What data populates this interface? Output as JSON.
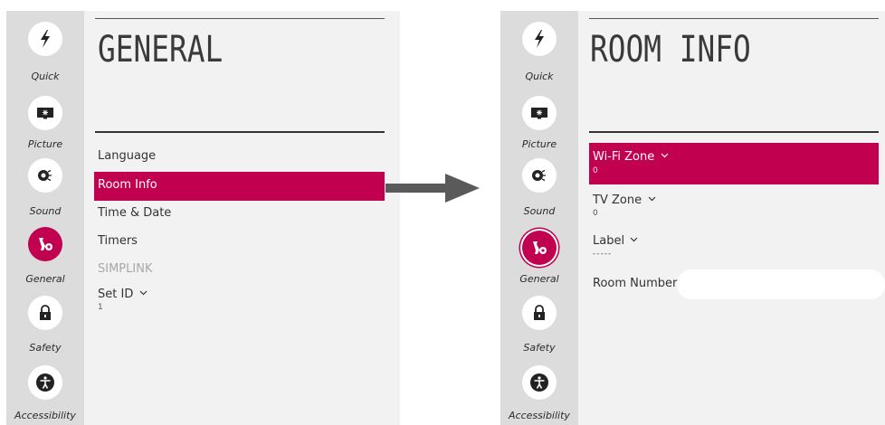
{
  "nav": {
    "items": [
      {
        "label": "Quick",
        "icon": "lightning-icon"
      },
      {
        "label": "Picture",
        "icon": "picture-icon"
      },
      {
        "label": "Sound",
        "icon": "sound-icon"
      },
      {
        "label": "General",
        "icon": "general-icon"
      },
      {
        "label": "Safety",
        "icon": "lock-icon"
      },
      {
        "label": "Accessibility",
        "icon": "accessibility-icon"
      }
    ],
    "active_item": "General"
  },
  "left_screen": {
    "title": "GENERAL",
    "menu": {
      "language": "Language",
      "room_info": "Room Info",
      "time_date": "Time & Date",
      "timers": "Timers",
      "simplink": "SIMPLINK",
      "set_id": "Set ID",
      "set_id_value": "1"
    },
    "selected": "Room Info"
  },
  "right_screen": {
    "title": "ROOM INFO",
    "menu": {
      "wifi_zone": "Wi-Fi Zone",
      "wifi_zone_value": "0",
      "tv_zone": "TV Zone",
      "tv_zone_value": "0",
      "label": "Label",
      "label_value": "-----",
      "room_number": "Room Number",
      "room_number_value": ""
    },
    "selected": "Wi-Fi Zone"
  },
  "colors": {
    "accent": "#c1004f",
    "sidebar_bg": "#dcdcdc",
    "content_bg": "#f2f2f2",
    "arrow": "#5a5a5a"
  }
}
